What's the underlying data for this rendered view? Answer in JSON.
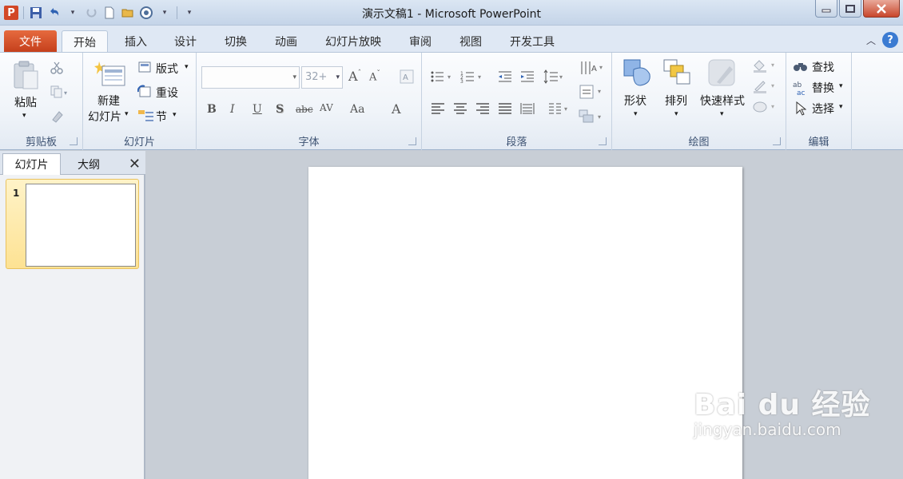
{
  "window": {
    "title": "演示文稿1 - Microsoft PowerPoint",
    "app_icon_letter": "P"
  },
  "tabs": [
    "文件",
    "开始",
    "插入",
    "设计",
    "切换",
    "动画",
    "幻灯片放映",
    "审阅",
    "视图",
    "开发工具"
  ],
  "active_tab": "开始",
  "help_label": "?",
  "ribbon": {
    "clipboard": {
      "paste": "粘贴",
      "group": "剪贴板"
    },
    "slides": {
      "new_line1": "新建",
      "new_line2": "幻灯片",
      "layout": "版式",
      "reset": "重设",
      "section": "节",
      "group": "幻灯片"
    },
    "font": {
      "font_name": "",
      "font_size": "32+",
      "group": "字体",
      "bold": "B",
      "italic": "I",
      "underline": "U",
      "shadow": "S",
      "strike": "abc",
      "spacing": "AV",
      "case": "Aa",
      "color": "A"
    },
    "paragraph": {
      "group": "段落"
    },
    "drawing": {
      "shapes": "形状",
      "arrange": "排列",
      "quick_styles": "快速样式",
      "group": "绘图"
    },
    "editing": {
      "find": "查找",
      "replace": "替换",
      "select": "选择",
      "group": "编辑"
    }
  },
  "pane": {
    "tab_slides": "幻灯片",
    "tab_outline": "大纲",
    "close": "✕",
    "slide_number": "1"
  },
  "watermark": {
    "logo": "Bai du 经验",
    "url": "jingyan.baidu.com"
  },
  "colors": {
    "file_tab": "#d24726",
    "ribbon_bg": "#f0f4f9",
    "canvas_bg": "#c8ced6",
    "selected_thumb": "#fde293"
  }
}
